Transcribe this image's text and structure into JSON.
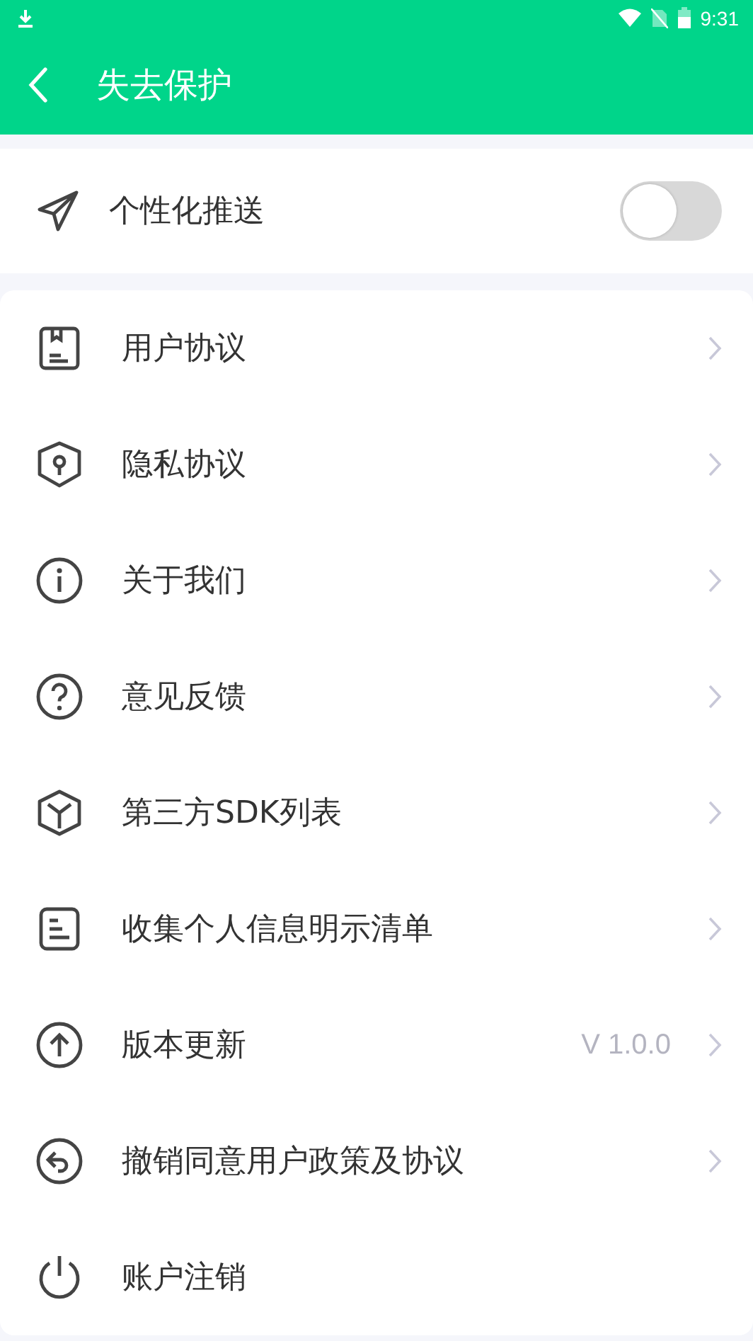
{
  "status_bar": {
    "time": "9:31"
  },
  "header": {
    "title": "失去保护"
  },
  "push_setting": {
    "label": "个性化推送",
    "on": false
  },
  "menu": [
    {
      "label": "用户协议",
      "chevron": true
    },
    {
      "label": "隐私协议",
      "chevron": true
    },
    {
      "label": "关于我们",
      "chevron": true
    },
    {
      "label": "意见反馈",
      "chevron": true
    },
    {
      "label": "第三方SDK列表",
      "chevron": true
    },
    {
      "label": "收集个人信息明示清单",
      "chevron": true
    },
    {
      "label": "版本更新",
      "value": "V 1.0.0",
      "chevron": true
    },
    {
      "label": "撤销同意用户政策及协议",
      "chevron": true
    },
    {
      "label": "账户注销",
      "chevron": false
    }
  ]
}
